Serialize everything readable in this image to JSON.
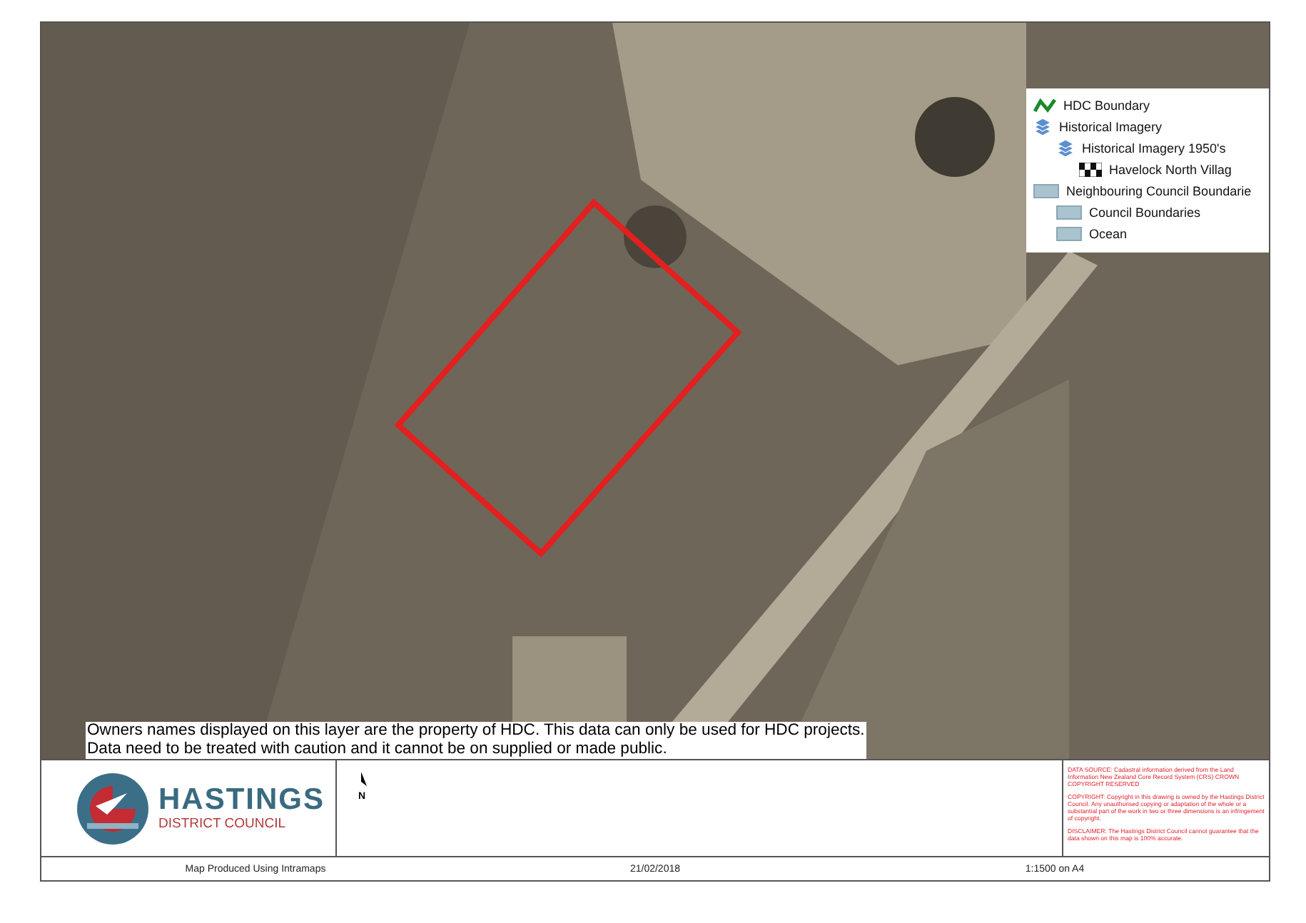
{
  "map": {
    "legend": [
      {
        "kind": "line",
        "label": "HDC Boundary"
      },
      {
        "kind": "layers",
        "label": "Historical Imagery",
        "children": [
          {
            "kind": "layers",
            "label": "Historical Imagery 1950's",
            "children": [
              {
                "kind": "raster",
                "label": "Havelock North Villag"
              }
            ]
          }
        ]
      },
      {
        "kind": "fill",
        "label": "Neighbouring Council Boundarie",
        "children": [
          {
            "kind": "fill",
            "label": "Council Boundaries"
          },
          {
            "kind": "fill",
            "label": "Ocean"
          }
        ]
      }
    ],
    "notice": "Owners names displayed on this layer are the property of HDC. This data can only be used for HDC projects. Data need to be treated with caution and it cannot be on supplied or made public."
  },
  "footer": {
    "logo": {
      "name": "HASTINGS",
      "subtitle": "DISTRICT COUNCIL"
    },
    "north_label": "N",
    "disclaimer": [
      "DATA SOURCE: Cadastral information derived from the Land Information New Zealand Core Record System (CRS) CROWN COPYRIGHT RESERVED",
      "COPYRIGHT: Copyright in this drawing is owned by the Hastings District Council. Any unauthorised copying or adaptation of the whole or a substantial part of the work in two or three dimensions is an infringement of copyright.",
      "DISCLAIMER: The Hastings District Council cannot guarantee that the data shown on this map is 100% accurate."
    ],
    "credit": "Map Produced Using Intramaps",
    "date": "21/02/2018",
    "scale": "1:1500 on A4"
  }
}
